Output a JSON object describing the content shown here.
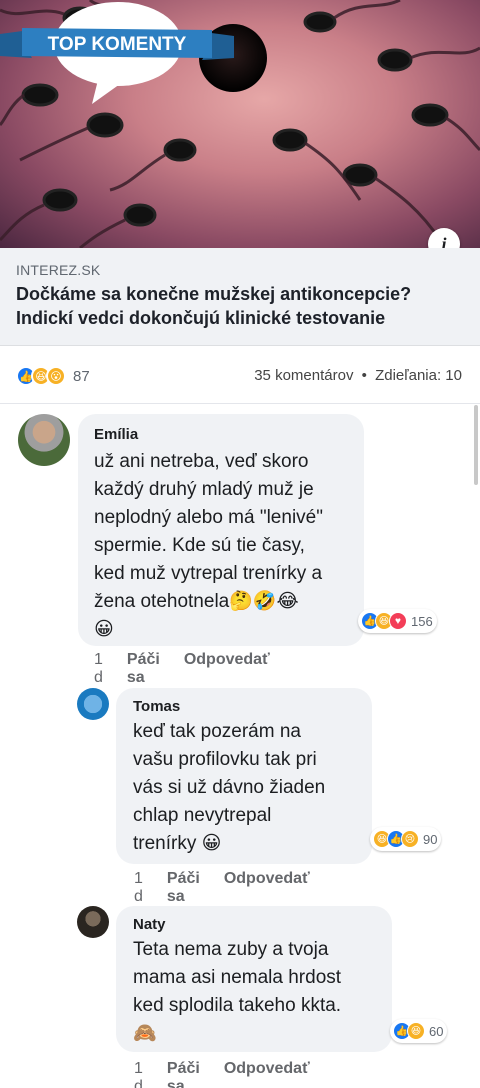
{
  "hero": {
    "badge_text": "TOP KOMENTY",
    "info_icon": "info-icon"
  },
  "link": {
    "domain": "INTEREZ.SK",
    "title": "Dočkáme sa konečne mužskej antikoncepcie? Indickí vedci dokončujú klinické testovanie"
  },
  "stats": {
    "reaction_icons": [
      "like-icon",
      "haha-icon",
      "wow-icon"
    ],
    "reaction_count": "87",
    "comments": "35 komentárov",
    "separator": "•",
    "shares": "Zdieľania: 10"
  },
  "comments": [
    {
      "author": "Emília",
      "text": "už ani netreba, veď skoro\nkaždý druhý mladý muž  je\nneplodný alebo má \"lenivé\"\nspermie. Kde sú tie časy,\nked muž vytrepal trenírky a\nžena otehotnela",
      "reactions": [
        "like-icon",
        "haha-icon",
        "love-icon"
      ],
      "reaction_count": "156",
      "time": "1 d",
      "like_label": "Páči sa mi to",
      "reply_label": "Odpovedať"
    },
    {
      "author": "Tomas",
      "text": "keď tak pozerám na\nvašu profilovku tak pri\nvás si už dávno žiaden\nchlap nevytrepal\ntrenírky",
      "reactions": [
        "haha-icon",
        "like-icon",
        "sad-icon"
      ],
      "reaction_count": "90",
      "time": "1 d",
      "like_label": "Páči sa mi to",
      "reply_label": "Odpovedať"
    },
    {
      "author": "Naty",
      "text": "Teta nema zuby a tvoja\nmama asi nemala hrdost\nked splodila takeho kkta.",
      "reactions": [
        "like-icon",
        "haha-icon"
      ],
      "reaction_count": "60",
      "time": "1 d",
      "like_label": "Páči sa mi to",
      "reply_label": "Odpovedať"
    }
  ],
  "colors": {
    "like": "#1877f2",
    "love": "#f33e58",
    "haha": "#f7b125",
    "badge": "#2d7fc1"
  }
}
